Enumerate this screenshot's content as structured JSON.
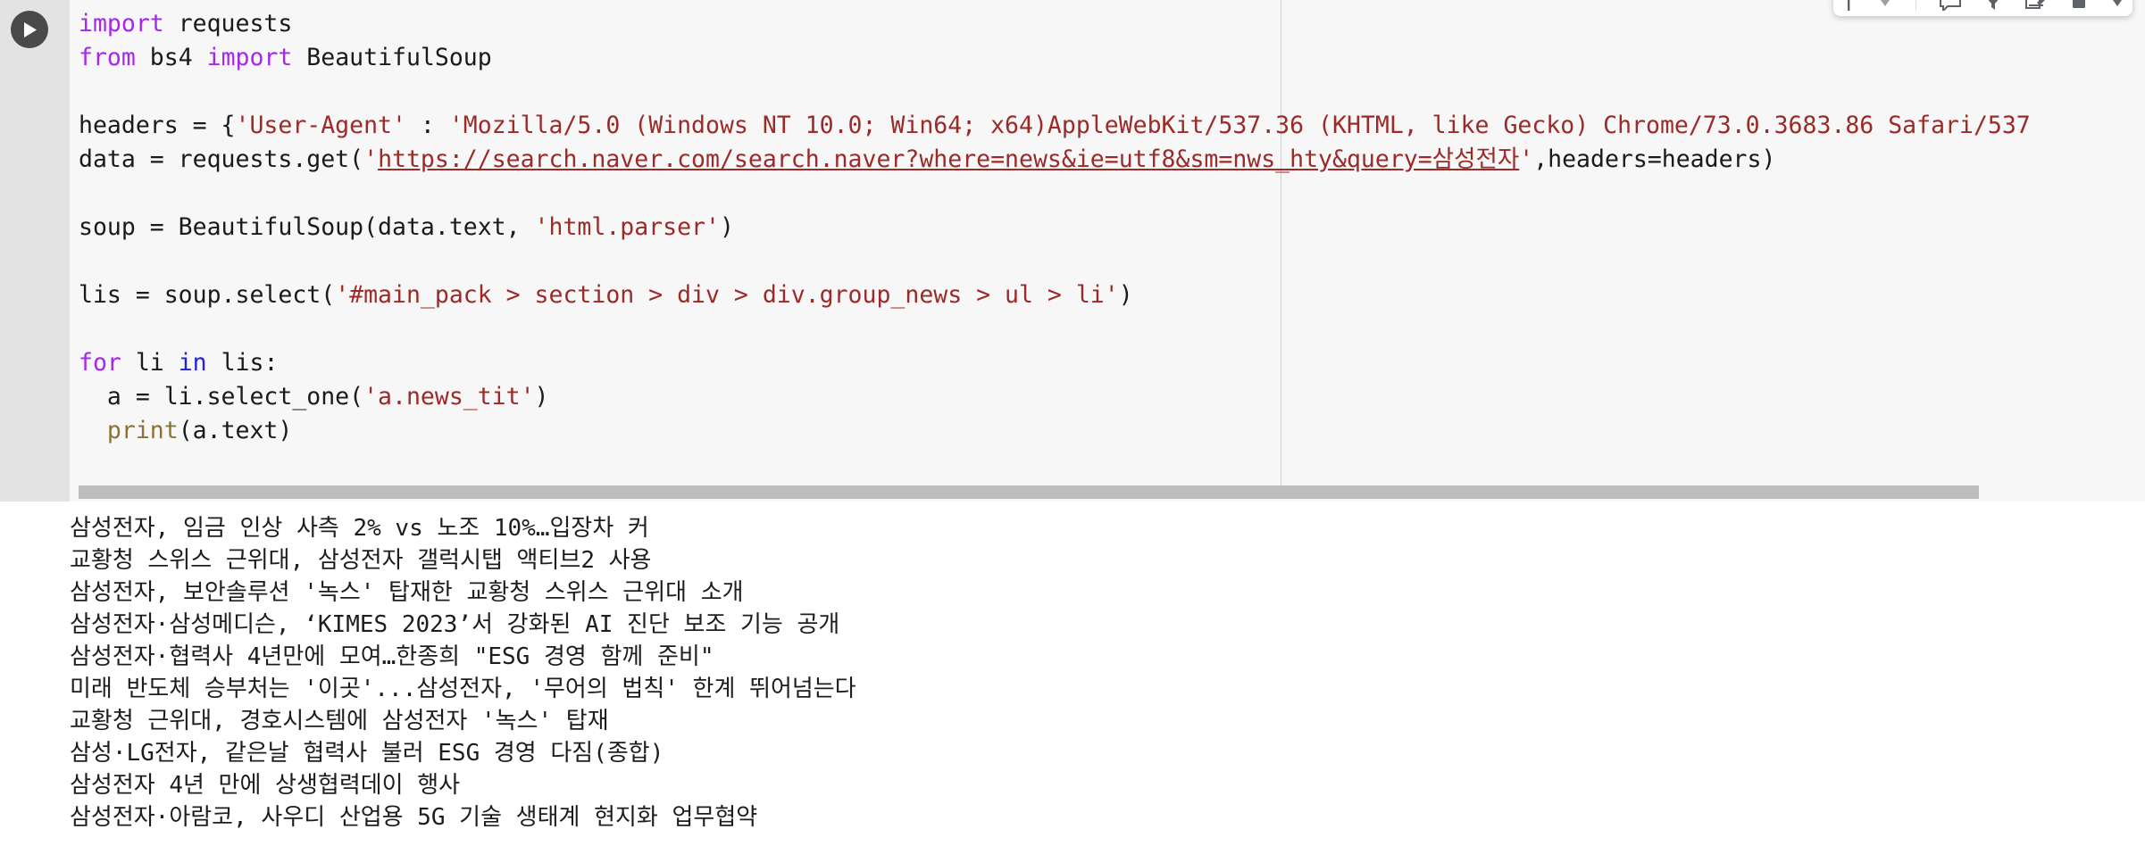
{
  "cell": {
    "run_button_label": "run-cell",
    "language": "python",
    "code_lines": [
      {
        "id": "l1",
        "tokens": [
          {
            "t": "import",
            "c": "kw"
          },
          {
            "t": " requests",
            "c": "plain"
          }
        ]
      },
      {
        "id": "l2",
        "tokens": [
          {
            "t": "from",
            "c": "kw"
          },
          {
            "t": " bs4 ",
            "c": "plain"
          },
          {
            "t": "import",
            "c": "kw"
          },
          {
            "t": " BeautifulSoup",
            "c": "plain"
          }
        ]
      },
      {
        "id": "l3",
        "tokens": []
      },
      {
        "id": "l4",
        "tokens": [
          {
            "t": "headers = {",
            "c": "plain"
          },
          {
            "t": "'User-Agent'",
            "c": "str"
          },
          {
            "t": " : ",
            "c": "plain"
          },
          {
            "t": "'Mozilla/5.0 (Windows NT 10.0; Win64; x64)AppleWebKit/537.36 (KHTML, like Gecko) Chrome/73.0.3683.86 Safari/537",
            "c": "str"
          }
        ]
      },
      {
        "id": "l5",
        "tokens": [
          {
            "t": "data = requests.get(",
            "c": "plain"
          },
          {
            "t": "'",
            "c": "str"
          },
          {
            "t": "https://search.naver.com/search.naver?where=news&ie=utf8&sm=nws_hty&query=삼성전자",
            "c": "link"
          },
          {
            "t": "'",
            "c": "str"
          },
          {
            "t": ",headers=headers)",
            "c": "plain"
          }
        ]
      },
      {
        "id": "l6",
        "tokens": []
      },
      {
        "id": "l7",
        "tokens": [
          {
            "t": "soup = BeautifulSoup(data.text, ",
            "c": "plain"
          },
          {
            "t": "'html.parser'",
            "c": "str"
          },
          {
            "t": ")",
            "c": "plain"
          }
        ]
      },
      {
        "id": "l8",
        "tokens": []
      },
      {
        "id": "l9",
        "tokens": [
          {
            "t": "lis = soup.select(",
            "c": "plain"
          },
          {
            "t": "'#main_pack > section > div > div.group_news > ul > li'",
            "c": "str"
          },
          {
            "t": ")",
            "c": "plain"
          }
        ]
      },
      {
        "id": "l10",
        "tokens": []
      },
      {
        "id": "l11",
        "tokens": [
          {
            "t": "for",
            "c": "kw"
          },
          {
            "t": " li ",
            "c": "plain"
          },
          {
            "t": "in",
            "c": "kw2"
          },
          {
            "t": " lis:",
            "c": "plain"
          }
        ]
      },
      {
        "id": "l12",
        "tokens": [
          {
            "t": "  a = li.select_one(",
            "c": "plain"
          },
          {
            "t": "'a.news_tit'",
            "c": "str"
          },
          {
            "t": ")",
            "c": "plain"
          }
        ]
      },
      {
        "id": "l13",
        "tokens": [
          {
            "t": "  ",
            "c": "plain"
          },
          {
            "t": "print",
            "c": "fn"
          },
          {
            "t": "(a.text)",
            "c": "plain"
          }
        ]
      }
    ]
  },
  "output": {
    "lines": [
      "삼성전자, 임금 인상 사측 2% vs 노조 10%…입장차 커",
      "교황청 스위스 근위대, 삼성전자 갤럭시탭 액티브2 사용",
      "삼성전자, 보안솔루션 '녹스' 탑재한 교황청 스위스 근위대 소개",
      "삼성전자·삼성메디슨, ‘KIMES 2023’서 강화된 AI 진단 보조 기능 공개",
      "삼성전자·협력사 4년만에 모여…한종희 \"ESG 경영 함께 준비\"",
      "미래 반도체 승부처는 '이곳'...삼성전자, '무어의 법칙' 한계 뛰어넘는다",
      "교황청 근위대, 경호시스템에 삼성전자 '녹스' 탑재",
      "삼성·LG전자, 같은날 협력사 불러 ESG 경영 다짐(종합)",
      "삼성전자 4년 만에 상생협력데이 행사",
      "삼성전자·아람코, 사우디 산업용 5G 기술 생태계 현지화 업무협약"
    ]
  },
  "toolbar": {
    "items": [
      {
        "name": "text-cursor-icon",
        "label": ""
      },
      {
        "name": "chevron-down-icon",
        "label": ""
      },
      {
        "name": "comment-icon",
        "label": ""
      },
      {
        "name": "filter-icon",
        "label": ""
      },
      {
        "name": "edit-note-icon",
        "label": ""
      },
      {
        "name": "delete-icon",
        "label": ""
      },
      {
        "name": "more-options-icon",
        "label": ""
      }
    ]
  },
  "colors": {
    "keyword": "#a626f0",
    "keyword_alt": "#2222dd",
    "string": "#9b2a28",
    "function": "#8a7332",
    "plain": "#1a1a1a",
    "cell_bg": "#f7f7f7",
    "gutter_bg": "#e3e3e3",
    "scrollbar": "#bdbdbd"
  }
}
